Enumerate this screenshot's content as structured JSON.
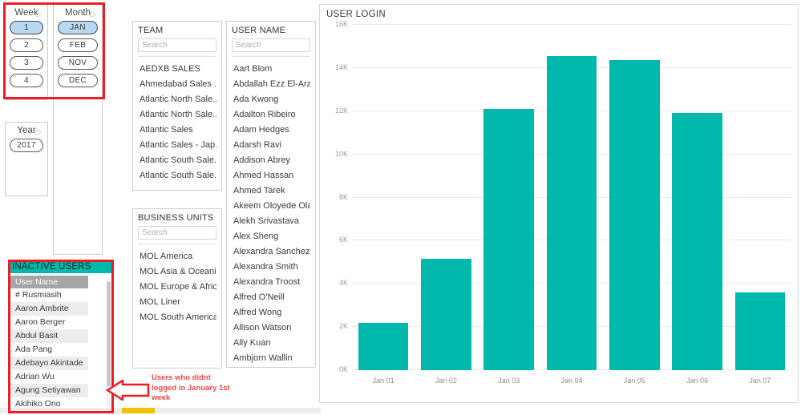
{
  "slicers": {
    "week": {
      "title": "Week",
      "clear_icon": "eraser-icon",
      "items": [
        {
          "label": "1",
          "selected": true
        },
        {
          "label": "2",
          "selected": false
        },
        {
          "label": "3",
          "selected": false
        },
        {
          "label": "4",
          "selected": false
        }
      ]
    },
    "month": {
      "title": "Month",
      "clear_icon": "eraser-icon",
      "items": [
        {
          "label": "JAN",
          "selected": true
        },
        {
          "label": "FEB",
          "selected": false
        },
        {
          "label": "NOV",
          "selected": false
        },
        {
          "label": "DEC",
          "selected": false
        }
      ]
    },
    "year": {
      "title": "Year",
      "clear_icon": "eraser-icon",
      "items": [
        {
          "label": "2017",
          "selected": false
        }
      ]
    }
  },
  "team_panel": {
    "title": "TEAM",
    "search_placeholder": "Search",
    "search_value": "",
    "items": [
      "AEDXB SALES",
      "Ahmedabad Sales ...",
      "Atlantic North Sale...",
      "Atlantic North Sale...",
      "Atlantic Sales",
      "Atlantic Sales - Jap...",
      "Atlantic South Sale...",
      "Atlantic South Sale..."
    ]
  },
  "business_units_panel": {
    "title": "BUSINESS UNITS",
    "search_placeholder": "Search",
    "search_value": "",
    "items": [
      "MOL America",
      "MOL Asia & Oceania",
      "MOL Europe & Africa",
      "MOL Liner",
      "MOL South America"
    ]
  },
  "user_name_panel": {
    "title": "USER NAME",
    "search_placeholder": "Search",
    "search_value": "",
    "items": [
      "Aart Blom",
      "Abdallah Ezz El-Arab",
      "Ada Kwong",
      "Adailton Ribeiro",
      "Adam Hedges",
      "Adarsh Ravi",
      "Addison Abrey",
      "Ahmed Hassan",
      "Ahmed Tarek",
      "Akeem Oloyede Ola...",
      "Alekh Srivastava",
      "Alex Sheng",
      "Alexandra Sanchez",
      "Alexandra Smith",
      "Alexandra Troost",
      "Alfred O'Neill",
      "Alfred Wong",
      "Allison Watson",
      "Ally Kuan",
      "Ambjorn Wallin"
    ]
  },
  "inactive_users": {
    "title": "INACTIVE USERS",
    "column_header": "User Name",
    "rows": [
      "# Rusmiasih",
      "Aaron Ambrite",
      "Aaron Berger",
      "Abdul Basit",
      "Ada Pang",
      "Adebayo Akintade",
      "Adrian Wu",
      "Agung Setiyawan",
      "Akihiko Ono"
    ]
  },
  "annotation": {
    "text": "Users who didnt logged in January 1st week",
    "arrow_icon": "arrow-left-icon",
    "color": "#f2474a"
  },
  "colors": {
    "bar_teal": "#01b8ac",
    "highlight_red": "#ee1c25",
    "selected_chip": "#b8d7f0",
    "scrollbar_yellow": "#f2c200"
  },
  "chart_data": {
    "type": "bar",
    "title": "USER LOGIN",
    "categories": [
      "Jan 01",
      "Jan 02",
      "Jan 03",
      "Jan 04",
      "Jan 05",
      "Jan 06",
      "Jan 07"
    ],
    "values": [
      2200,
      5150,
      12100,
      14550,
      14350,
      11900,
      3600
    ],
    "xlabel": "",
    "ylabel": "",
    "ylim": [
      0,
      16000
    ],
    "yticks": [
      0,
      2000,
      4000,
      6000,
      8000,
      10000,
      12000,
      14000,
      16000
    ],
    "ytick_labels": [
      "0K",
      "2K",
      "4K",
      "6K",
      "8K",
      "10K",
      "12K",
      "14K",
      "16K"
    ],
    "grid": true,
    "legend": false,
    "series_color": "#01b8ac"
  }
}
